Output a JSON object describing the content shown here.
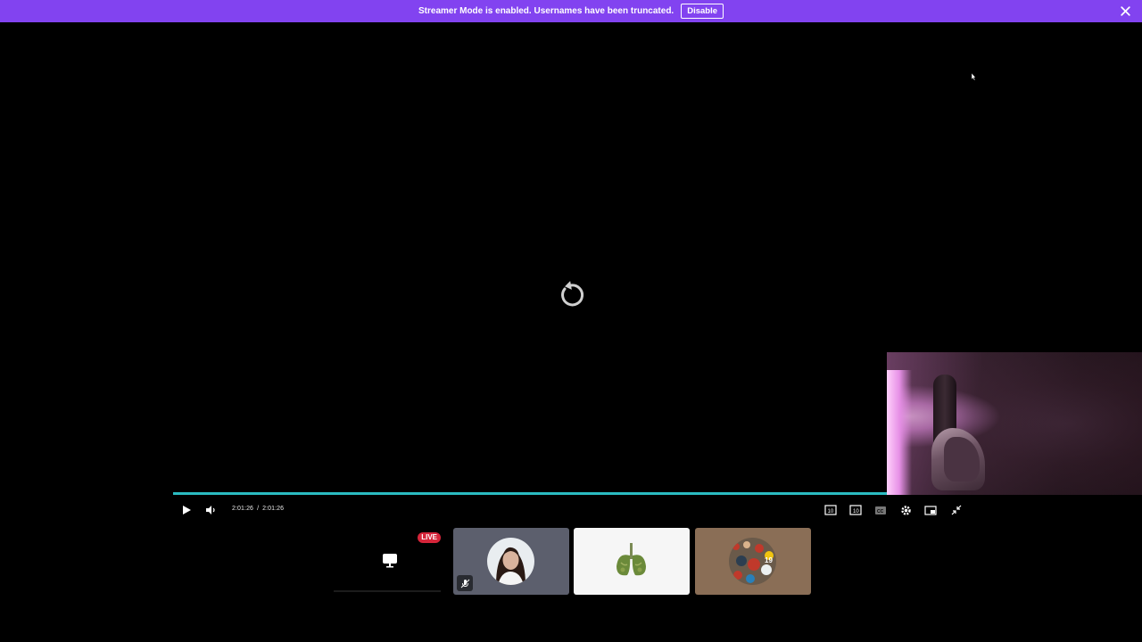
{
  "banner": {
    "message": "Streamer Mode is enabled. Usernames have been truncated.",
    "disable_label": "Disable"
  },
  "player": {
    "current_time": "2:01:26",
    "separator": "/",
    "duration": "2:01:26",
    "progress_fraction": 1.0,
    "accent_color": "#2bbcc2"
  },
  "controls": {
    "icons": [
      "play-icon",
      "volume-icon",
      "rewind-10-icon",
      "forward-10-icon",
      "captions-icon",
      "settings-icon",
      "picture-in-picture-icon",
      "exit-fullscreen-icon"
    ]
  },
  "thumbnails": [
    {
      "kind": "screen-share",
      "badge": "LIVE"
    },
    {
      "kind": "participant",
      "muted": true
    },
    {
      "kind": "participant"
    },
    {
      "kind": "participant"
    }
  ],
  "colors": {
    "banner": "#8243f0",
    "live_badge": "#d6253a"
  }
}
